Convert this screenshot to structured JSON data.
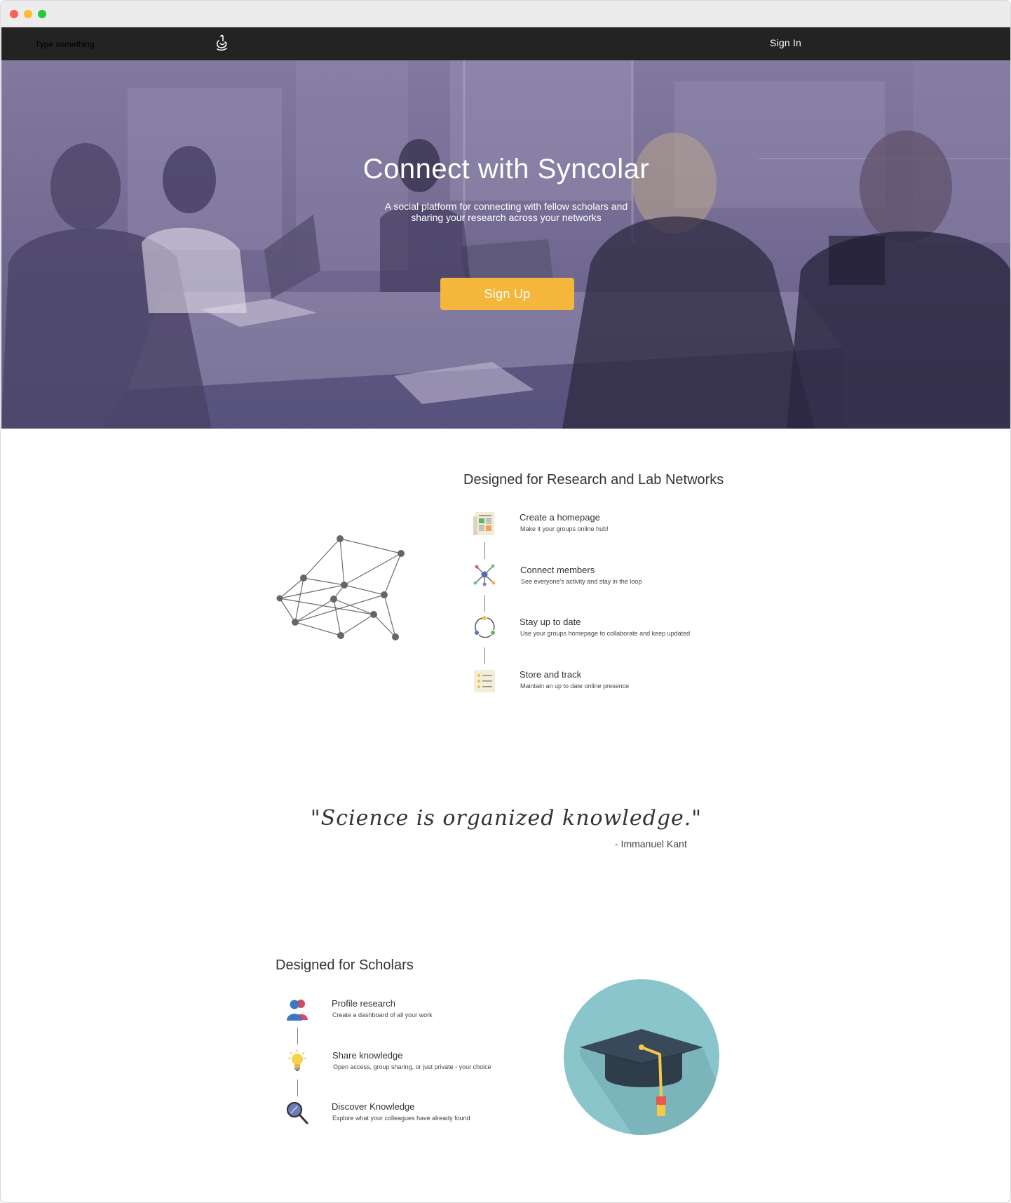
{
  "navbar": {
    "search_placeholder": "Type something",
    "signin_label": "Sign In"
  },
  "hero": {
    "title": "Connect with Syncolar",
    "subtitle_line1": "A social platform for connecting with fellow scholars and",
    "subtitle_line2": "sharing your research across your networks",
    "signup_label": "Sign Up"
  },
  "lab_section": {
    "heading": "Designed for Research and Lab Networks",
    "features": [
      {
        "title": "Create a homepage",
        "desc": "Make it your groups online hub!",
        "icon": "newspaper-icon"
      },
      {
        "title": "Connect members",
        "desc": "See everyone's activity and stay in the loop",
        "icon": "network-hub-icon"
      },
      {
        "title": "Stay up to date",
        "desc": "Use your groups homepage to collaborate and keep updated",
        "icon": "sync-cycle-icon"
      },
      {
        "title": "Store and track",
        "desc": "Maintain an up to date online presence",
        "icon": "checklist-icon"
      }
    ]
  },
  "quote": {
    "text": "\"Science is organized knowledge.\"",
    "author": "- Immanuel Kant"
  },
  "scholar_section": {
    "heading": "Designed for Scholars",
    "features": [
      {
        "title": "Profile research",
        "desc": "Create a dashboard of all your work",
        "icon": "users-icon"
      },
      {
        "title": "Share knowledge",
        "desc": "Open access, group sharing, or just private - your choice",
        "icon": "lightbulb-icon"
      },
      {
        "title": "Discover Knowledge",
        "desc": "Explore what your colleagues have already found",
        "icon": "magnifier-icon"
      }
    ]
  },
  "colors": {
    "nav_bg": "#232323",
    "hero_overlay": "#756b92",
    "accent": "#f4b63b",
    "cap_circle": "#8ac5cb"
  }
}
